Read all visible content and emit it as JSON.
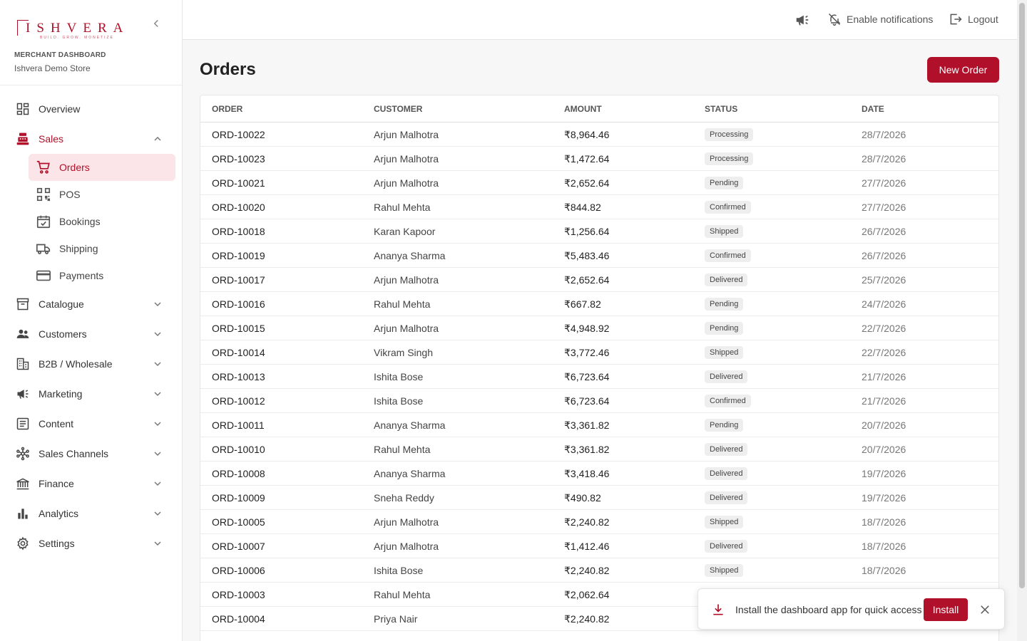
{
  "brand": {
    "logo_text": "ISHVERA",
    "logo_tagline": "BUILD. GROW. MONETIZE",
    "section_label": "MERCHANT DASHBOARD",
    "store_name": "Ishvera Demo Store"
  },
  "sidebar": {
    "items": [
      {
        "label": "Overview",
        "icon": "dashboard-icon"
      },
      {
        "label": "Sales",
        "icon": "register-icon",
        "expanded": true
      },
      {
        "label": "Catalogue",
        "icon": "archive-icon"
      },
      {
        "label": "Customers",
        "icon": "people-icon"
      },
      {
        "label": "B2B / Wholesale",
        "icon": "building-icon"
      },
      {
        "label": "Marketing",
        "icon": "megaphone-icon"
      },
      {
        "label": "Content",
        "icon": "article-icon"
      },
      {
        "label": "Sales Channels",
        "icon": "hub-icon"
      },
      {
        "label": "Finance",
        "icon": "bank-icon"
      },
      {
        "label": "Analytics",
        "icon": "bar-chart-icon"
      },
      {
        "label": "Settings",
        "icon": "gear-icon"
      }
    ],
    "sales_children": [
      {
        "label": "Orders",
        "icon": "cart-icon",
        "active": true
      },
      {
        "label": "POS",
        "icon": "qr-icon"
      },
      {
        "label": "Bookings",
        "icon": "calendar-check-icon"
      },
      {
        "label": "Shipping",
        "icon": "truck-icon"
      },
      {
        "label": "Payments",
        "icon": "credit-card-icon"
      }
    ]
  },
  "topbar": {
    "notifications_label": "Enable notifications",
    "logout_label": "Logout"
  },
  "page": {
    "title": "Orders",
    "new_order_label": "New Order"
  },
  "table": {
    "columns": [
      "ORDER",
      "CUSTOMER",
      "AMOUNT",
      "STATUS",
      "DATE"
    ],
    "rows": [
      [
        "ORD-10022",
        "Arjun Malhotra",
        "₹8,964.46",
        "Processing",
        "28/7/2026"
      ],
      [
        "ORD-10023",
        "Arjun Malhotra",
        "₹1,472.64",
        "Processing",
        "28/7/2026"
      ],
      [
        "ORD-10021",
        "Arjun Malhotra",
        "₹2,652.64",
        "Pending",
        "27/7/2026"
      ],
      [
        "ORD-10020",
        "Rahul Mehta",
        "₹844.82",
        "Confirmed",
        "27/7/2026"
      ],
      [
        "ORD-10018",
        "Karan Kapoor",
        "₹1,256.64",
        "Shipped",
        "26/7/2026"
      ],
      [
        "ORD-10019",
        "Ananya Sharma",
        "₹5,483.46",
        "Confirmed",
        "26/7/2026"
      ],
      [
        "ORD-10017",
        "Arjun Malhotra",
        "₹2,652.64",
        "Delivered",
        "25/7/2026"
      ],
      [
        "ORD-10016",
        "Rahul Mehta",
        "₹667.82",
        "Pending",
        "24/7/2026"
      ],
      [
        "ORD-10015",
        "Arjun Malhotra",
        "₹4,948.92",
        "Pending",
        "22/7/2026"
      ],
      [
        "ORD-10014",
        "Vikram Singh",
        "₹3,772.46",
        "Shipped",
        "22/7/2026"
      ],
      [
        "ORD-10013",
        "Ishita Bose",
        "₹6,723.64",
        "Delivered",
        "21/7/2026"
      ],
      [
        "ORD-10012",
        "Ishita Bose",
        "₹6,723.64",
        "Confirmed",
        "21/7/2026"
      ],
      [
        "ORD-10011",
        "Ananya Sharma",
        "₹3,361.82",
        "Pending",
        "20/7/2026"
      ],
      [
        "ORD-10010",
        "Rahul Mehta",
        "₹3,361.82",
        "Delivered",
        "20/7/2026"
      ],
      [
        "ORD-10008",
        "Ananya Sharma",
        "₹3,418.46",
        "Delivered",
        "19/7/2026"
      ],
      [
        "ORD-10009",
        "Sneha Reddy",
        "₹490.82",
        "Delivered",
        "19/7/2026"
      ],
      [
        "ORD-10005",
        "Arjun Malhotra",
        "₹2,240.82",
        "Shipped",
        "18/7/2026"
      ],
      [
        "ORD-10007",
        "Arjun Malhotra",
        "₹1,412.46",
        "Delivered",
        "18/7/2026"
      ],
      [
        "ORD-10006",
        "Ishita Bose",
        "₹2,240.82",
        "Shipped",
        "18/7/2026"
      ],
      [
        "ORD-10003",
        "Rahul Mehta",
        "₹2,062.64",
        "",
        ""
      ],
      [
        "ORD-10004",
        "Priya Nair",
        "₹2,240.82",
        "",
        ""
      ]
    ]
  },
  "toast": {
    "message": "Install the dashboard app for quick access",
    "install_label": "Install"
  },
  "colors": {
    "accent": "#b0102a",
    "active_bg": "#fbe5e8"
  }
}
